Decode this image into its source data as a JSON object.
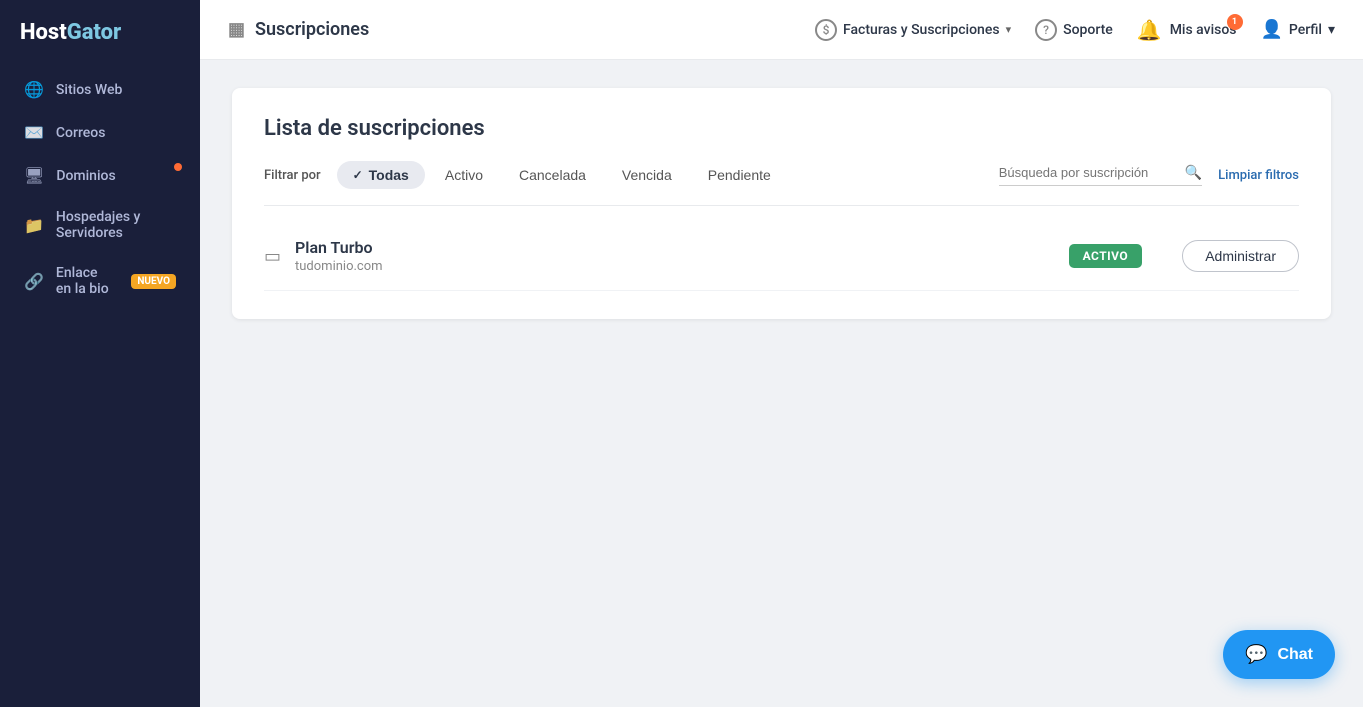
{
  "brand": {
    "name_part1": "Host",
    "name_part2": "Gator"
  },
  "sidebar": {
    "items": [
      {
        "id": "sitios-web",
        "label": "Sitios Web",
        "icon": "🌐",
        "badge": null,
        "dot": false
      },
      {
        "id": "correos",
        "label": "Correos",
        "icon": "✉️",
        "badge": null,
        "dot": false
      },
      {
        "id": "dominios",
        "label": "Dominios",
        "icon": "🖥",
        "badge": null,
        "dot": true
      },
      {
        "id": "hospedajes",
        "label": "Hospedajes y Servidores",
        "icon": "📁",
        "badge": null,
        "dot": false
      },
      {
        "id": "enlace-bio",
        "label": "Enlace en la bio",
        "icon": "🔗",
        "badge": "NUEVO",
        "dot": false
      }
    ]
  },
  "topnav": {
    "page_icon": "▦",
    "page_title": "Suscripciones",
    "menu_billing": "Facturas y Suscripciones",
    "menu_soporte": "Soporte",
    "menu_avisos": "Mis avisos",
    "avisos_badge": "1",
    "menu_perfil": "Perfil"
  },
  "main": {
    "card_title": "Lista de suscripciones",
    "filter_label": "Filtrar por",
    "filters": [
      {
        "id": "todas",
        "label": "Todas",
        "active": true
      },
      {
        "id": "activo",
        "label": "Activo",
        "active": false
      },
      {
        "id": "cancelada",
        "label": "Cancelada",
        "active": false
      },
      {
        "id": "vencida",
        "label": "Vencida",
        "active": false
      },
      {
        "id": "pendiente",
        "label": "Pendiente",
        "active": false
      }
    ],
    "search_placeholder": "Búsqueda por suscripción",
    "clear_filters_label": "Limpiar filtros",
    "subscriptions": [
      {
        "name": "Plan Turbo",
        "domain": "tudominio.com",
        "status": "ACTIVO",
        "status_color": "#38a169",
        "manage_label": "Administrar"
      }
    ]
  },
  "chat": {
    "label": "Chat"
  }
}
